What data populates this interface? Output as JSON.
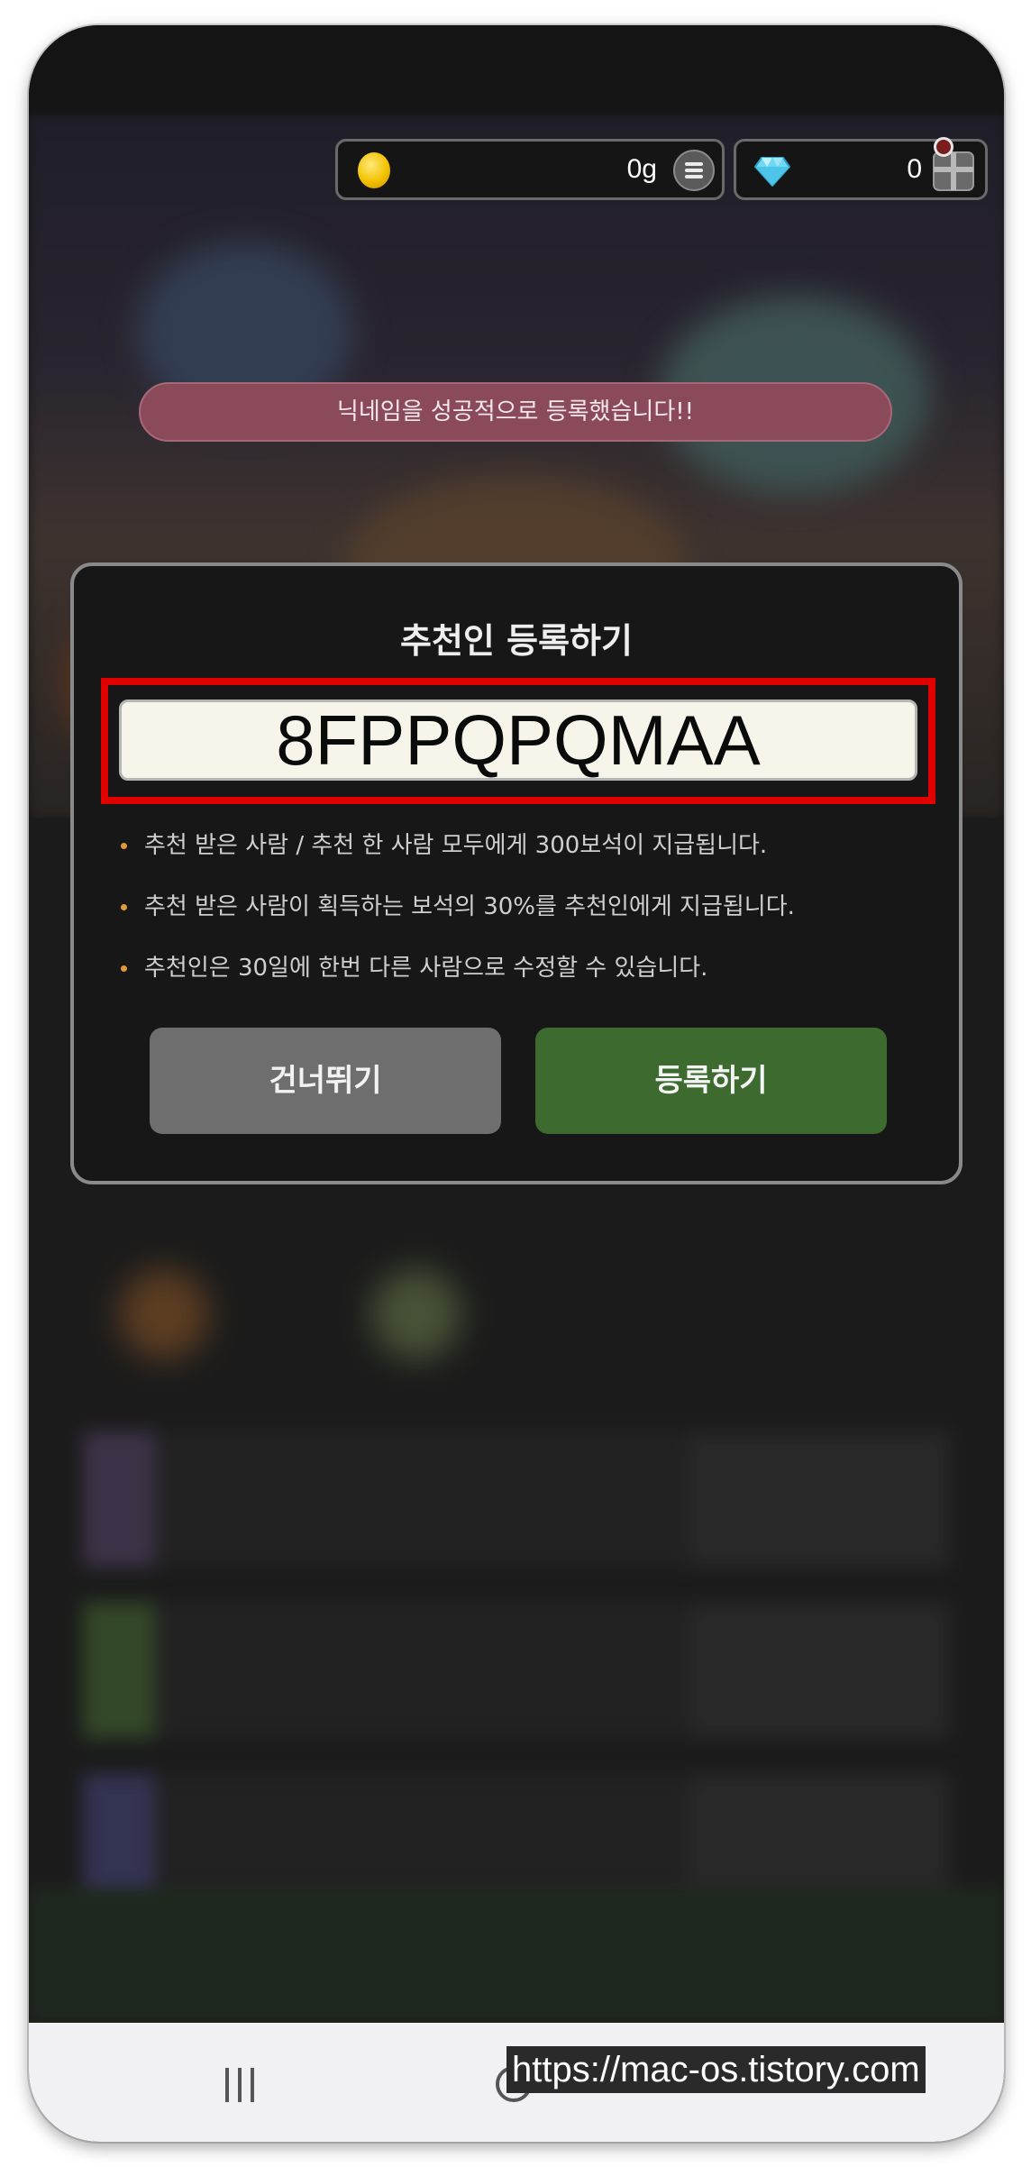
{
  "currency": {
    "gold": {
      "icon": "gold-coin-icon",
      "value": "0g"
    },
    "gems": {
      "icon": "diamond-icon",
      "value": "0"
    }
  },
  "toast": {
    "message": "닉네임을 성공적으로 등록했습니다!!"
  },
  "modal": {
    "title": "추천인 등록하기",
    "referral_code_value": "8FPPQPQMAA",
    "info": [
      "추천 받은 사람 / 추천 한 사람 모두에게 300보석이 지급됩니다.",
      "추천 받은 사람이 획득하는 보석의 30%를 추천인에게 지급됩니다.",
      "추천인은 30일에 한번 다른 사람으로 수정할 수 있습니다."
    ],
    "skip_label": "건너뛰기",
    "register_label": "등록하기"
  },
  "watermark": "https://mac-os.tistory.com",
  "colors": {
    "toast_bg": "#8a4a5a",
    "register_button": "#3d6a2f",
    "skip_button": "#6e6e6e",
    "highlight_border": "#e00000",
    "bullet": "#e09a3a"
  }
}
